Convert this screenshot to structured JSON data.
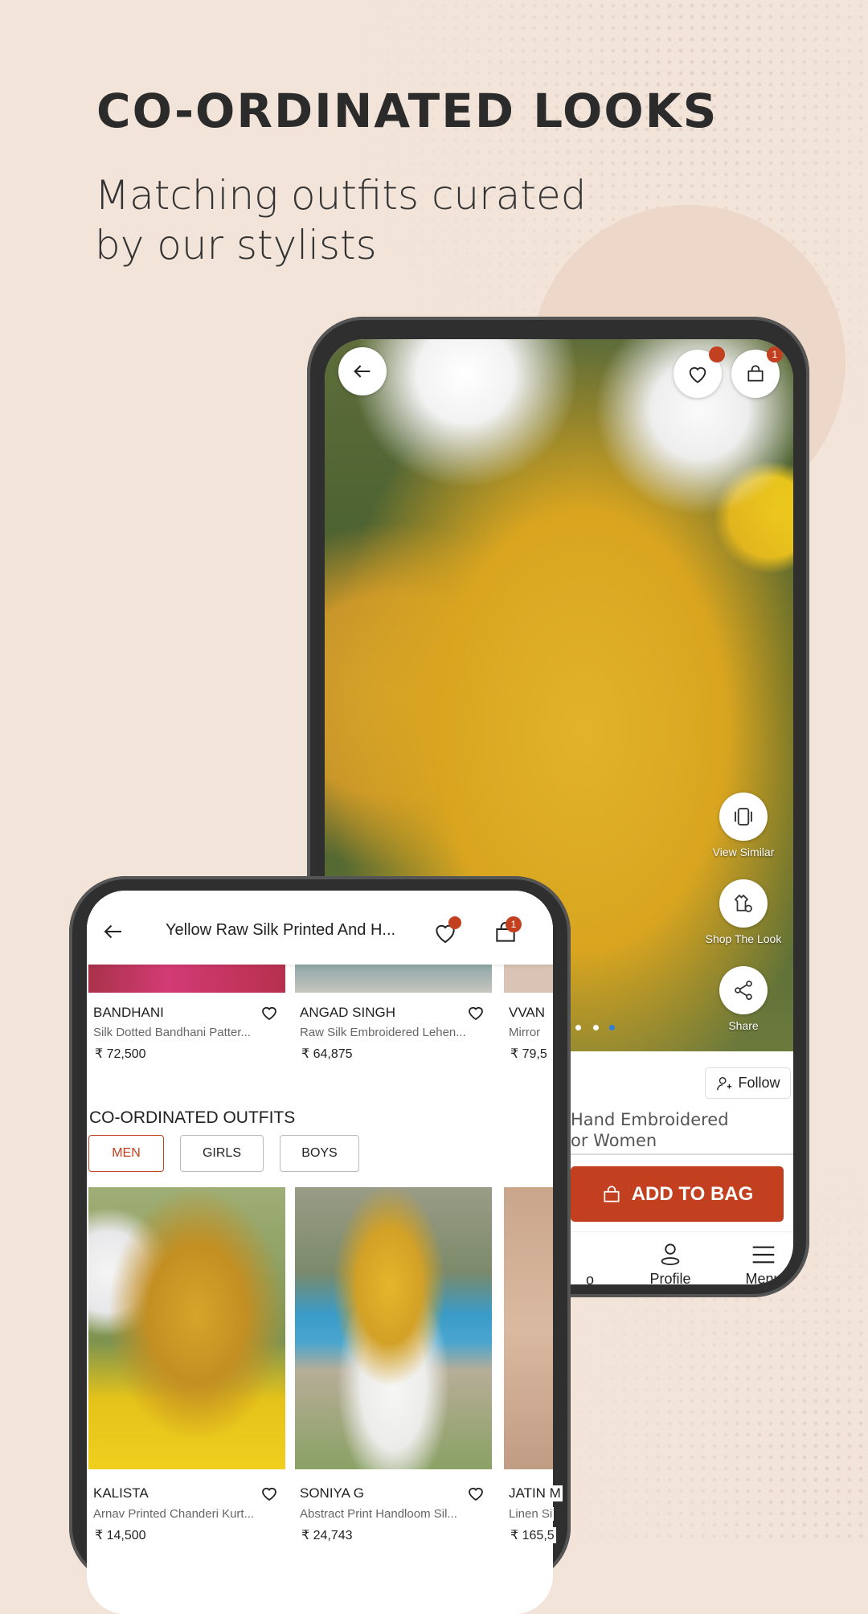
{
  "headline": "CO-ORDINATED LOOKS",
  "subtitle_lines": [
    "Matching outfits curated",
    "by our stylists"
  ],
  "colors": {
    "accent": "#c2401f",
    "background": "#f3e4da"
  },
  "back_phone": {
    "wishlist_icon": "heart-icon",
    "bag_badge": "1",
    "side_actions": [
      {
        "label": "View Similar",
        "icon": "similar-icon"
      },
      {
        "label": "Shop The Look",
        "icon": "outfit-icon"
      },
      {
        "label": "Share",
        "icon": "share-icon"
      }
    ],
    "follow_label": "Follow",
    "product_title_lines": [
      "Hand Embroidered",
      "or Women"
    ],
    "add_to_bag": "ADD TO BAG",
    "nav": [
      {
        "label": "o"
      },
      {
        "label": "Profile"
      },
      {
        "label": "Menu"
      }
    ]
  },
  "front_phone": {
    "title": "Yellow Raw Silk Printed And H...",
    "bag_badge": "1",
    "top_products": [
      {
        "brand": "BANDHANI",
        "desc": "Silk Dotted Bandhani Patter...",
        "price": "₹ 72,500"
      },
      {
        "brand": "ANGAD SINGH",
        "desc": "Raw Silk Embroidered Lehen...",
        "price": "₹ 64,875"
      },
      {
        "brand": "VVAN",
        "desc": "Mirror",
        "price": "₹ 79,5"
      }
    ],
    "section_title": "CO-ORDINATED OUTFITS",
    "chips": [
      {
        "label": "MEN",
        "selected": true
      },
      {
        "label": "GIRLS",
        "selected": false
      },
      {
        "label": "BOYS",
        "selected": false
      }
    ],
    "outfits": [
      {
        "brand": "KALISTA",
        "desc": "Arnav Printed Chanderi Kurt...",
        "price": "₹ 14,500"
      },
      {
        "brand": "SONIYA G",
        "desc": "Abstract Print Handloom Sil...",
        "price": "₹ 24,743"
      },
      {
        "brand": "JATIN M",
        "desc": "Linen Si",
        "price": "₹ 165,5"
      }
    ]
  }
}
